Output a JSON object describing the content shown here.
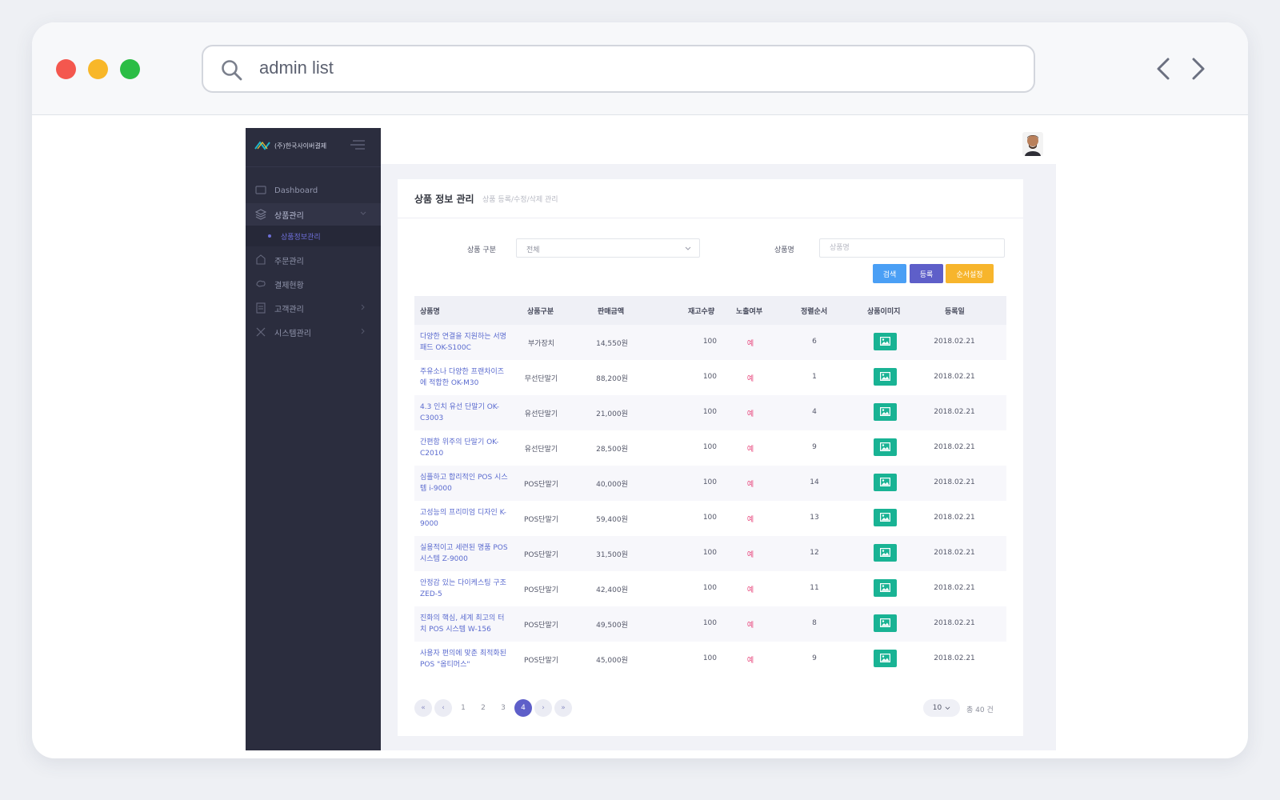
{
  "browser": {
    "url": "admin list"
  },
  "sidebar": {
    "brand": "(주)한국사이버결제",
    "items": [
      {
        "label": "Dashboard",
        "icon": "dashboard-icon"
      },
      {
        "label": "상품관리",
        "icon": "box-icon"
      },
      {
        "label": "주문관리",
        "icon": "order-icon"
      },
      {
        "label": "결제현황",
        "icon": "payment-icon"
      },
      {
        "label": "고객관리",
        "icon": "customer-icon"
      },
      {
        "label": "시스템관리",
        "icon": "settings-icon"
      }
    ],
    "submenu": {
      "label": "상품정보관리"
    }
  },
  "page": {
    "title": "상품 정보 관리",
    "subtitle": "상품 등록/수정/삭제 관리"
  },
  "filters": {
    "category_label": "상품 구분",
    "category_value": "전체",
    "name_label": "상품명",
    "name_placeholder": "상품명"
  },
  "buttons": {
    "search": "검색",
    "register": "등록",
    "order": "순서설정"
  },
  "colors": {
    "search_btn": "#4a9ff5",
    "register_btn": "#5e5fc9",
    "order_btn": "#f7b52c",
    "image_btn": "#19b394",
    "sidebar_bg": "#2b2d3e"
  },
  "table": {
    "headers": [
      "상품명",
      "상품구분",
      "판매금액",
      "재고수량",
      "노출여부",
      "정렬순서",
      "상품이미지",
      "등록일"
    ],
    "rows": [
      {
        "name": "다양한 연결을 지원하는 서명패드 OK-S100C",
        "category": "부가장치",
        "price": "14,550원",
        "stock": "100",
        "visible": "예",
        "order": "6",
        "date": "2018.02.21"
      },
      {
        "name": "주유소나 다양한 프랜차이즈에 적합한 OK-M30",
        "category": "무선단말기",
        "price": "88,200원",
        "stock": "100",
        "visible": "예",
        "order": "1",
        "date": "2018.02.21"
      },
      {
        "name": "4.3 인치 유선 단말기 OK-C3003",
        "category": "유선단말기",
        "price": "21,000원",
        "stock": "100",
        "visible": "예",
        "order": "4",
        "date": "2018.02.21"
      },
      {
        "name": "간편함 위주의 단말기 OK-C2010",
        "category": "유선단말기",
        "price": "28,500원",
        "stock": "100",
        "visible": "예",
        "order": "9",
        "date": "2018.02.21"
      },
      {
        "name": "심플하고 합리적인 POS 시스템 i-9000",
        "category": "POS단말기",
        "price": "40,000원",
        "stock": "100",
        "visible": "예",
        "order": "14",
        "date": "2018.02.21"
      },
      {
        "name": "고성능의 프리미엄 디자인 K-9000",
        "category": "POS단말기",
        "price": "59,400원",
        "stock": "100",
        "visible": "예",
        "order": "13",
        "date": "2018.02.21"
      },
      {
        "name": "실용적이고 세련된 명품 POS 시스템 Z-9000",
        "category": "POS단말기",
        "price": "31,500원",
        "stock": "100",
        "visible": "예",
        "order": "12",
        "date": "2018.02.21"
      },
      {
        "name": "안정감 있는 다이케스팅 구조 ZED-5",
        "category": "POS단말기",
        "price": "42,400원",
        "stock": "100",
        "visible": "예",
        "order": "11",
        "date": "2018.02.21"
      },
      {
        "name": "진화의 핵심, 세계 최고의 터치 POS 시스템 W-156",
        "category": "POS단말기",
        "price": "49,500원",
        "stock": "100",
        "visible": "예",
        "order": "8",
        "date": "2018.02.21"
      },
      {
        "name": "사용자 편의에 맞춘 최적화된 POS \"옵티머스\"",
        "category": "POS단말기",
        "price": "45,000원",
        "stock": "100",
        "visible": "예",
        "order": "9",
        "date": "2018.02.21"
      }
    ]
  },
  "pagination": {
    "first": "«",
    "prev": "‹",
    "pages": [
      "1",
      "2",
      "3",
      "4"
    ],
    "current": "4",
    "next": "›",
    "last": "»",
    "per_page": "10",
    "total": "총 40 건"
  }
}
